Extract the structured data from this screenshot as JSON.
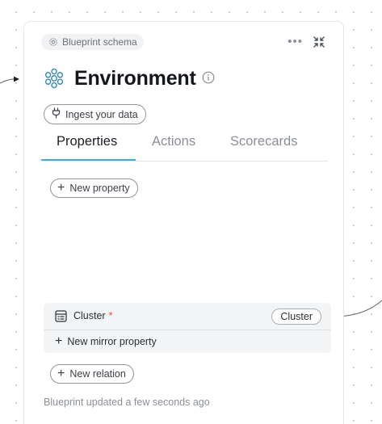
{
  "header": {
    "schema_chip_label": "Blueprint schema",
    "more_label": "•••",
    "title": "Environment"
  },
  "ingest_button_label": "Ingest your data",
  "tabs": [
    {
      "label": "Properties",
      "active": true
    },
    {
      "label": "Actions",
      "active": false
    },
    {
      "label": "Scorecards",
      "active": false
    }
  ],
  "properties": {
    "new_property_label": "New property"
  },
  "relation": {
    "label": "Cluster",
    "required_mark": "*",
    "target": "Cluster",
    "new_mirror_label": "New mirror property"
  },
  "new_relation_label": "New relation",
  "footer": {
    "status_text": "Blueprint updated a few seconds ago"
  },
  "colors": {
    "accent": "#34b3e3",
    "entity_icon": "#3c8fb3",
    "required": "#e5553b"
  },
  "icons": {
    "schema_chip": "gear-icon",
    "collapse": "collapse-icon",
    "entity": "environment-icon",
    "info": "info-icon",
    "ingest": "plug-icon",
    "relation": "list-icon"
  }
}
